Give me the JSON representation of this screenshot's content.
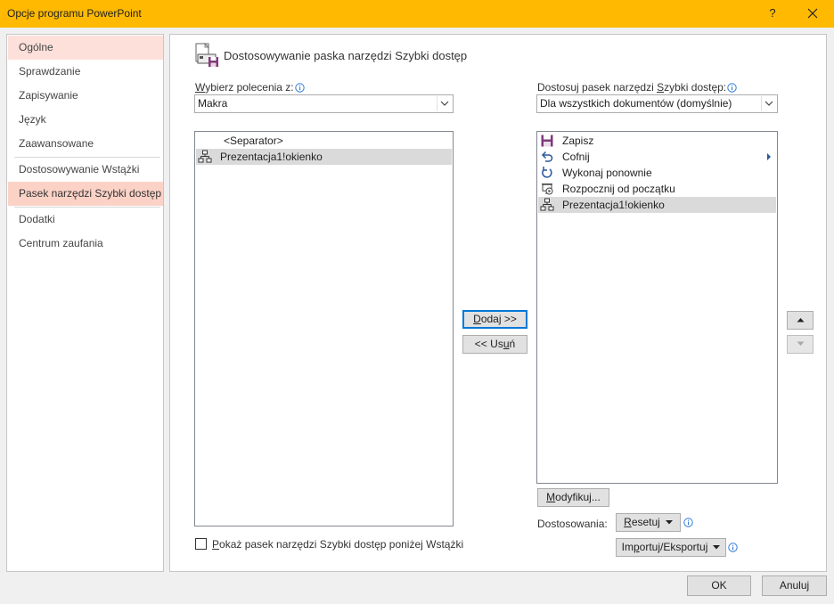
{
  "window": {
    "title": "Opcje programu PowerPoint",
    "help_label": "?"
  },
  "nav": {
    "items": [
      {
        "label": "Ogólne"
      },
      {
        "label": "Sprawdzanie"
      },
      {
        "label": "Zapisywanie"
      },
      {
        "label": "Język"
      },
      {
        "label": "Zaawansowane"
      },
      {
        "label": "Dostosowywanie Wstążki"
      },
      {
        "label": "Pasek narzędzi Szybki dostęp"
      },
      {
        "label": "Dodatki"
      },
      {
        "label": "Centrum zaufania"
      }
    ],
    "selected_index": 6
  },
  "page": {
    "heading": "Dostosowywanie paska narzędzi Szybki dostęp"
  },
  "left": {
    "label_pre": "W",
    "label_rest": "ybierz polecenia z:",
    "combo_value": "Makra",
    "items": [
      {
        "label": "<Separator>",
        "icon": "none"
      },
      {
        "label": "Prezentacja1!okienko",
        "icon": "macro-icon"
      }
    ],
    "selected_index": 1
  },
  "right": {
    "label_pre": "Dostosuj pasek narzędzi ",
    "label_u": "S",
    "label_rest": "zybki dostęp:",
    "combo_value": "Dla wszystkich dokumentów (domyślnie)",
    "items": [
      {
        "label": "Zapisz",
        "icon": "save-icon"
      },
      {
        "label": "Cofnij",
        "icon": "undo-icon"
      },
      {
        "label": "Wykonaj ponownie",
        "icon": "redo-icon"
      },
      {
        "label": "Rozpocznij od początku",
        "icon": "slideshow-start-icon"
      },
      {
        "label": "Prezentacja1!okienko",
        "icon": "macro-icon"
      }
    ],
    "selected_index": 4
  },
  "buttons": {
    "add_u": "D",
    "add_rest": "odaj >>",
    "remove_pre": "<< Us",
    "remove_u": "u",
    "remove_rest": "ń",
    "modify_u": "M",
    "modify_rest": "odyfikuj...",
    "customizations_label": "Dostosowania:",
    "reset_u": "R",
    "reset_rest": "esetuj",
    "import_pre": "Im",
    "import_u": "p",
    "import_rest": "ortuj/Eksportuj",
    "ok": "OK",
    "cancel": "Anuluj"
  },
  "checkbox": {
    "label_u": "P",
    "label_rest": "okaż pasek narzędzi Szybki dostęp poniżej Wstążki",
    "checked": false
  },
  "colors": {
    "title_bar": "#ffb900",
    "nav_selected": "#fcd2c7",
    "nav_hover": "#fde0da",
    "save_purple": "#80397b",
    "accent_blue": "#0078d7"
  }
}
